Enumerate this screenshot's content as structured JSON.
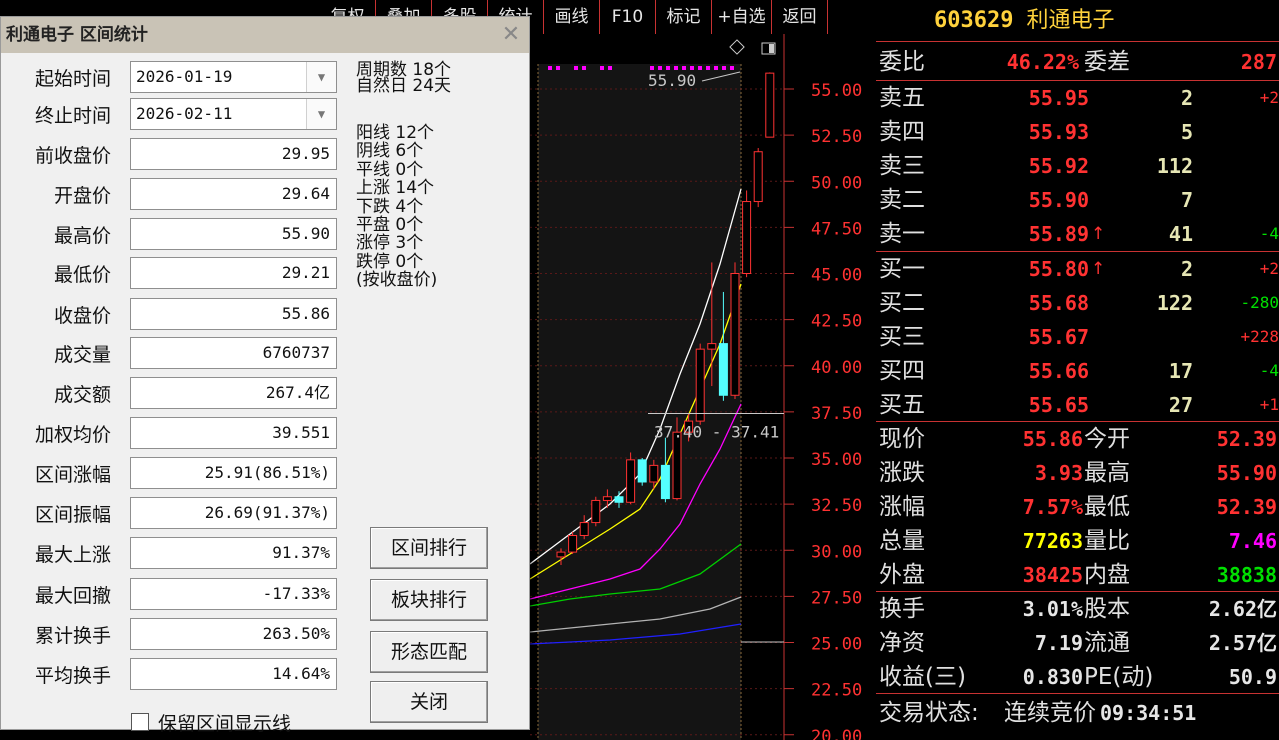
{
  "toolbar": {
    "buttons": [
      "复权",
      "叠加",
      "多股",
      "统计",
      "画线",
      "F10",
      "标记",
      "+自选",
      "返回"
    ]
  },
  "chart": {
    "price_axis": [
      "55.00",
      "52.50",
      "50.00",
      "47.50",
      "45.00",
      "42.50",
      "40.00",
      "37.50",
      "35.00",
      "32.50",
      "30.00",
      "27.50",
      "25.00",
      "22.50",
      "20.00"
    ],
    "high_marker": "55.90",
    "range_marker": "37.40 - 37.41",
    "colors": {
      "up": "#ff3232",
      "down": "#54ffff",
      "ma1": "#ffffff",
      "ma2": "#ffff00",
      "ma3": "#ff00ff",
      "ma4": "#00d000",
      "ma5": "#b4b4b4",
      "ma6": "#2020ff"
    }
  },
  "quote": {
    "code": "603629",
    "name": "利通电子",
    "weibi_label": "委比",
    "weibi_value": "46.22%",
    "weicha_label": "委差",
    "weicha_value": "287",
    "asks": [
      {
        "label": "卖五",
        "price": "55.95",
        "vol": "2",
        "chg": "+2"
      },
      {
        "label": "卖四",
        "price": "55.93",
        "vol": "5",
        "chg": ""
      },
      {
        "label": "卖三",
        "price": "55.92",
        "vol": "112",
        "chg": ""
      },
      {
        "label": "卖二",
        "price": "55.90",
        "vol": "7",
        "chg": ""
      },
      {
        "label": "卖一",
        "price": "55.89",
        "vol": "41",
        "chg": "-4",
        "arrow": "up"
      }
    ],
    "bids": [
      {
        "label": "买一",
        "price": "55.80",
        "vol": "2",
        "chg": "+2",
        "arrow": "up"
      },
      {
        "label": "买二",
        "price": "55.68",
        "vol": "122",
        "chg": "-280"
      },
      {
        "label": "买三",
        "price": "55.67",
        "vol": "",
        "chg": "+228"
      },
      {
        "label": "买四",
        "price": "55.66",
        "vol": "17",
        "chg": "-4"
      },
      {
        "label": "买五",
        "price": "55.65",
        "vol": "27",
        "chg": "+1"
      }
    ],
    "stats": [
      {
        "l1": "现价",
        "v1": "55.86",
        "l2": "今开",
        "v2": "52.39",
        "c1": "#ff3232",
        "c2": "#ff3232"
      },
      {
        "l1": "涨跌",
        "v1": "3.93",
        "l2": "最高",
        "v2": "55.90",
        "c1": "#ff3232",
        "c2": "#ff3232"
      },
      {
        "l1": "涨幅",
        "v1": "7.57%",
        "l2": "最低",
        "v2": "52.39",
        "c1": "#ff3232",
        "c2": "#ff3232"
      },
      {
        "l1": "总量",
        "v1": "77263",
        "l2": "量比",
        "v2": "7.46",
        "c1": "#ffff00",
        "c2": "#ff00ff"
      },
      {
        "l1": "外盘",
        "v1": "38425",
        "l2": "内盘",
        "v2": "38838",
        "c1": "#ff3232",
        "c2": "#00e000"
      },
      {
        "l1": "换手",
        "v1": "3.01%",
        "l2": "股本",
        "v2": "2.62亿",
        "c1": "#e6e6e6",
        "c2": "#e6e6e6"
      },
      {
        "l1": "净资",
        "v1": "7.19",
        "l2": "流通",
        "v2": "2.57亿",
        "c1": "#e6e6e6",
        "c2": "#e6e6e6"
      },
      {
        "l1": "收益(三)",
        "v1": "0.830",
        "l2": "PE(动)",
        "v2": "50.9",
        "c1": "#e6e6e6",
        "c2": "#e6e6e6"
      }
    ],
    "trade_status_label": "交易状态:",
    "trade_status": "连续竞价",
    "trade_time": "09:34:51"
  },
  "dialog": {
    "title": "利通电子 区间统计",
    "fields": [
      {
        "label": "起始时间",
        "value": "2026-01-19",
        "combo": true
      },
      {
        "label": "终止时间",
        "value": "2026-02-11",
        "combo": true
      },
      {
        "label": "前收盘价",
        "value": "29.95"
      },
      {
        "label": "开盘价",
        "value": "29.64"
      },
      {
        "label": "最高价",
        "value": "55.90"
      },
      {
        "label": "最低价",
        "value": "29.21"
      },
      {
        "label": "收盘价",
        "value": "55.86"
      },
      {
        "label": "成交量",
        "value": "6760737"
      },
      {
        "label": "成交额",
        "value": "267.4亿"
      },
      {
        "label": "加权均价",
        "value": "39.551"
      },
      {
        "label": "区间涨幅",
        "value": "25.91(86.51%)"
      },
      {
        "label": "区间振幅",
        "value": "26.69(91.37%)"
      },
      {
        "label": "最大上涨",
        "value": "91.37%"
      },
      {
        "label": "最大回撤",
        "value": "-17.33%"
      },
      {
        "label": "累计换手",
        "value": "263.50%"
      },
      {
        "label": "平均换手",
        "value": "14.64%"
      }
    ],
    "summary1": [
      "周期数 18个",
      "自然日 24天"
    ],
    "summary2": [
      "阳线 12个",
      "阴线 6个",
      "平线 0个",
      "上涨 14个",
      "下跌 4个",
      "平盘 0个",
      "涨停 3个",
      "跌停 0个",
      "(按收盘价)"
    ],
    "buttons": [
      "区间排行",
      "板块排行",
      "形态匹配",
      "关闭"
    ],
    "checkbox_label": "保留区间显示线"
  }
}
